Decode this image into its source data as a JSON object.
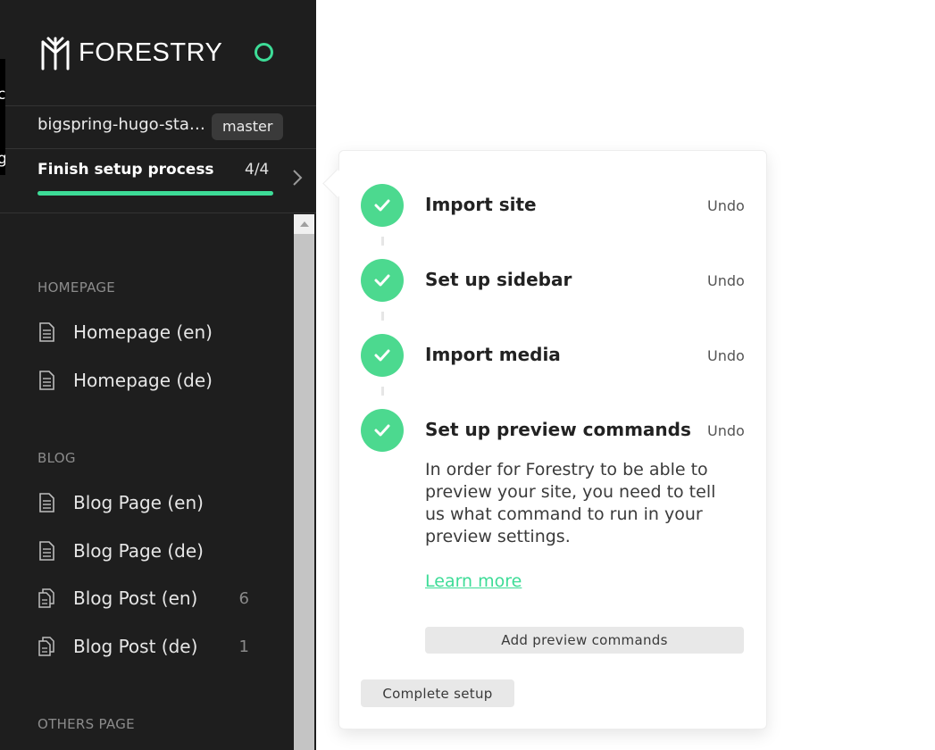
{
  "app": {
    "brand": "FORESTRY",
    "accent_color": "#3ddc97",
    "edge_fragments": [
      "c",
      "g"
    ]
  },
  "repo": {
    "name": "bigspring-hugo-sta…",
    "branch": "master"
  },
  "setup": {
    "label": "Finish setup process",
    "count": "4/4",
    "progress": 1.0
  },
  "sidebar": {
    "sections": [
      {
        "title": "HOMEPAGE",
        "items": [
          {
            "label": "Homepage (en)",
            "icon": "document-icon",
            "count": ""
          },
          {
            "label": "Homepage (de)",
            "icon": "document-icon",
            "count": ""
          }
        ]
      },
      {
        "title": "BLOG",
        "items": [
          {
            "label": "Blog Page (en)",
            "icon": "document-icon",
            "count": ""
          },
          {
            "label": "Blog Page (de)",
            "icon": "document-icon",
            "count": ""
          },
          {
            "label": "Blog Post (en)",
            "icon": "documents-icon",
            "count": "6"
          },
          {
            "label": "Blog Post (de)",
            "icon": "documents-icon",
            "count": "1"
          }
        ]
      },
      {
        "title": "OTHERS PAGE",
        "items": []
      }
    ]
  },
  "panel": {
    "steps": [
      {
        "title": "Import site",
        "undo": "Undo",
        "done": true
      },
      {
        "title": "Set up sidebar",
        "undo": "Undo",
        "done": true
      },
      {
        "title": "Import media",
        "undo": "Undo",
        "done": true
      },
      {
        "title": "Set up preview commands",
        "undo": "Undo",
        "done": true
      }
    ],
    "description_lines": [
      "In order for Forestry to be able to",
      "preview your site, you need to tell",
      "us what command to run in your",
      "preview settings."
    ],
    "learn_more": "Learn more",
    "add_button": "Add preview commands",
    "complete_button": "Complete setup"
  }
}
